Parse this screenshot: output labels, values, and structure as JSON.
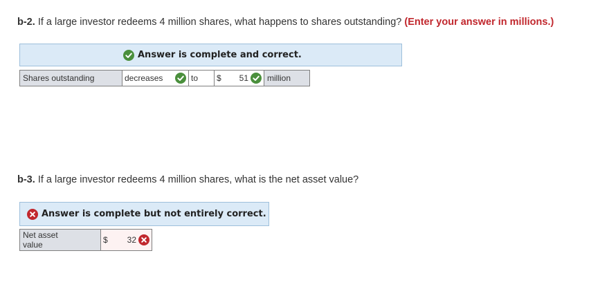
{
  "q_b2": {
    "number": "b-2.",
    "text": "If a large investor redeems 4 million shares, what happens to shares outstanding?",
    "hint": "(Enter your answer in millions.)"
  },
  "banner_b2": {
    "text": "Answer is complete and correct.",
    "status": "correct",
    "icon": "check-circle-icon",
    "color": "#4a8f3c"
  },
  "row_b2": {
    "label": "Shares outstanding",
    "direction": "decreases",
    "to": "to",
    "currency": "$",
    "value": "51",
    "unit": "million"
  },
  "q_b3": {
    "number": "b-3.",
    "text": "If a large investor redeems 4 million shares, what is the net asset value?"
  },
  "banner_b3": {
    "text": "Answer is complete but not entirely correct.",
    "status": "incorrect",
    "icon": "x-circle-icon",
    "color": "#c1272d"
  },
  "row_b3": {
    "label": "Net asset value",
    "currency": "$",
    "value": "32"
  }
}
